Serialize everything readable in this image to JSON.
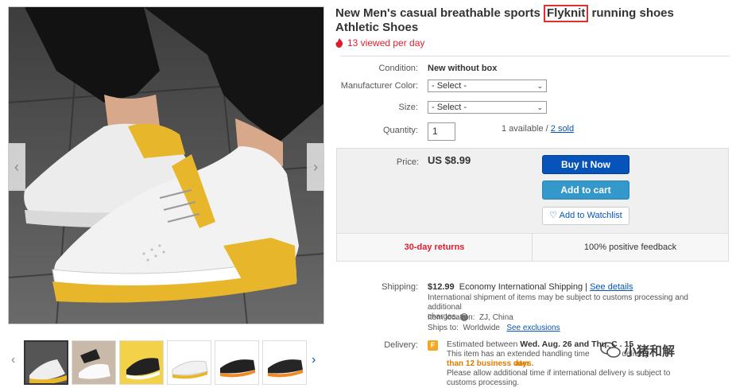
{
  "product": {
    "title_before": "New Men's casual breathable sports ",
    "title_highlight": "Flyknit",
    "title_after": " running shoes Athletic Shoes",
    "views": "13 viewed per day"
  },
  "details": {
    "condition_label": "Condition:",
    "condition_value": "New without box",
    "color_label": "Manufacturer Color:",
    "color_value": "- Select -",
    "size_label": "Size:",
    "size_value": "- Select -",
    "quantity_label": "Quantity:",
    "quantity_value": "1",
    "available_text": "1 available / ",
    "sold_link": "2 sold"
  },
  "buybox": {
    "price_label": "Price:",
    "price_value": "US $8.99",
    "buy_now": "Buy It Now",
    "add_to_cart": "Add to cart",
    "watchlist": "Add to Watchlist",
    "returns": "30-day returns",
    "feedback": "100% positive feedback"
  },
  "shipping": {
    "label": "Shipping:",
    "cost": "$12.99",
    "method": "Economy International Shipping",
    "divider": " | ",
    "see_details": "See details",
    "note1": "International shipment of items may be subject to customs processing and additional",
    "note2": "charges.",
    "location_label": "Item location:",
    "location": "ZJ, China",
    "ships_label": "Ships to:",
    "ships_to": "Worldwide",
    "see_exclusions": "See exclusions"
  },
  "delivery": {
    "label": "Delivery:",
    "estimated": "Estimated between",
    "dates": "Wed. Aug. 26 and Thu. C  . 15",
    "handling_a": "This item has an extended handling time",
    "handling_b": "delivery",
    "orange_a": "ater",
    "orange_b": "than 12 business days.",
    "note3": "Please allow additional time if international delivery is subject to",
    "note4": "customs processing."
  },
  "watermark": "小猪和解",
  "colors": {
    "accent_blue": "#0654ba",
    "cart_blue": "#3498ca",
    "red": "#dd1e31",
    "highlight_red": "#e0312f",
    "sole_yellow": "#e8b62a"
  }
}
